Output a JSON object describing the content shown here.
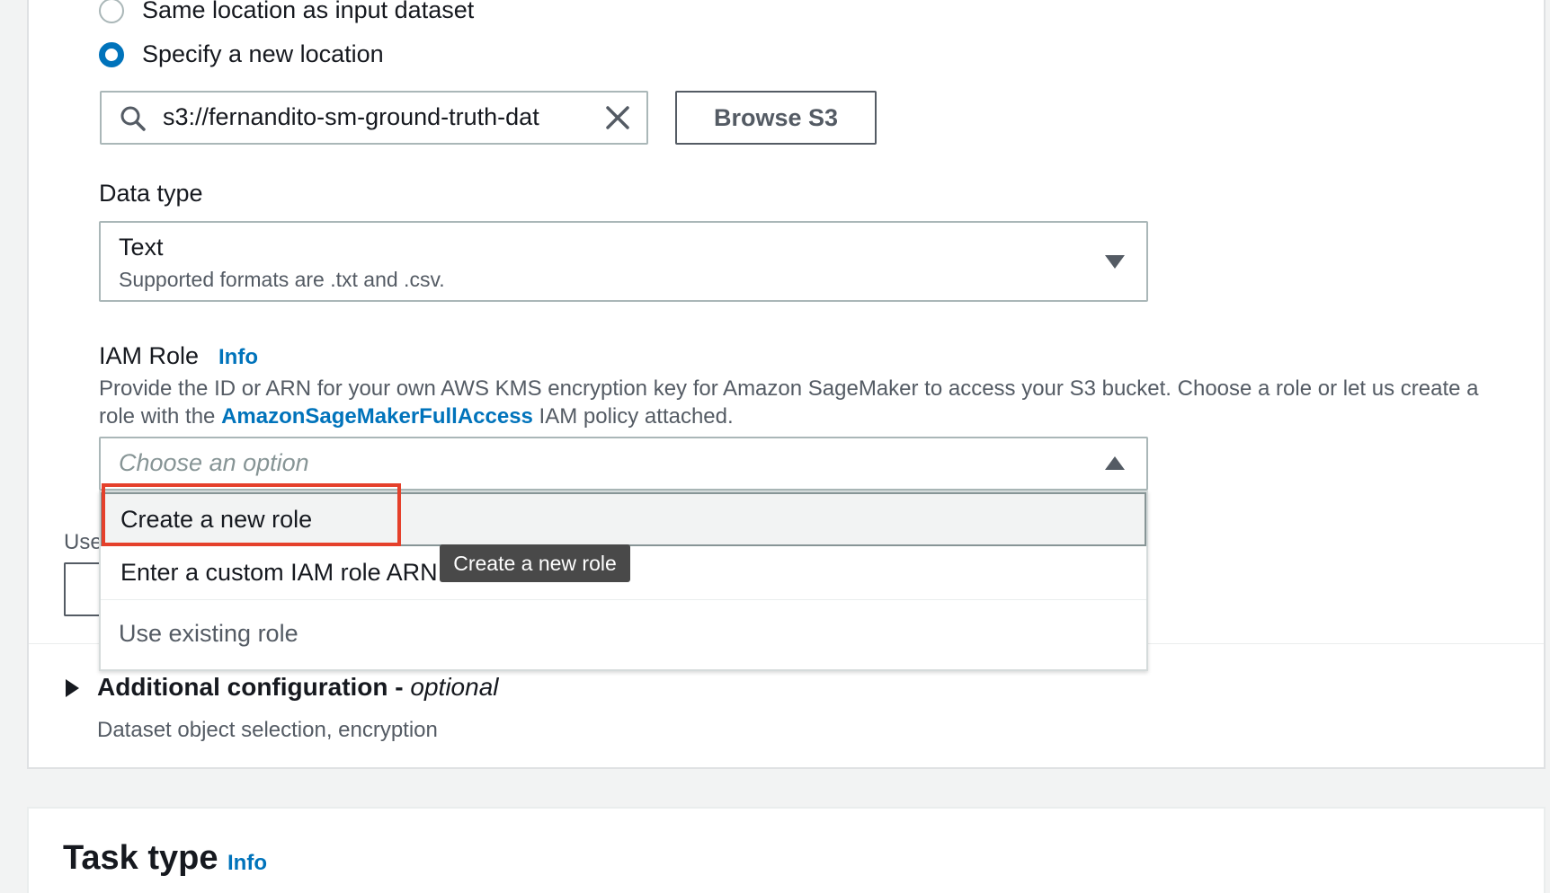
{
  "output_location": {
    "options": [
      {
        "label": "Same location as input dataset",
        "checked": false
      },
      {
        "label": "Specify a new location",
        "checked": true
      }
    ],
    "s3_path_value": "s3://fernandito-sm-ground-truth-dat",
    "browse_button": "Browse S3"
  },
  "data_type": {
    "label": "Data type",
    "selected_title": "Text",
    "selected_description": "Supported formats are .txt and .csv."
  },
  "iam_role": {
    "label": "IAM Role",
    "info_link": "Info",
    "description_before_link": "Provide the ID or ARN for your own AWS KMS encryption key for Amazon SageMaker to access your S3 bucket. Choose a role or let us create a role with the ",
    "description_link": "AmazonSageMakerFullAccess",
    "description_after_link": " IAM policy attached.",
    "placeholder": "Choose an option",
    "options": [
      "Create a new role",
      "Enter a custom IAM role ARN",
      "Use existing role"
    ],
    "tooltip": "Create a new role",
    "partially_hidden_label": "Use"
  },
  "additional_configuration": {
    "title": "Additional configuration - ",
    "optional": "optional",
    "description": "Dataset object selection, encryption"
  },
  "task_type": {
    "title": "Task type",
    "info_link": "Info"
  },
  "colors": {
    "accent": "#0073bb",
    "highlight_box": "#e5402b",
    "tooltip_bg": "#494949"
  }
}
